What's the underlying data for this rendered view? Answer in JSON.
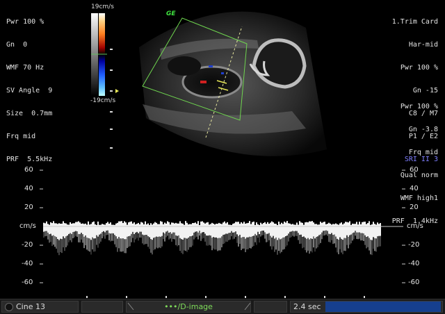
{
  "left_params": [
    "Pwr 100 %",
    "Gn  0",
    "WMF 70 Hz",
    "SV Angle  9",
    "Size  0.7mm",
    "Frq mid",
    "PRF  5.5kHz"
  ],
  "right_params_top": [
    "1.Trim Card",
    "Har-mid",
    "Pwr 100 %",
    "Gn -15",
    "C8 / M7",
    "P1 / E2"
  ],
  "sri_label": "SRI II 3",
  "right_params_bottom": [
    "Pwr 100 %",
    "Gn -3.8",
    "Frq mid",
    "Qual norm",
    "WMF high1",
    "PRF  1.4kHz"
  ],
  "color_scale": {
    "top": "19cm/s",
    "bottom": "-19cm/s"
  },
  "grey_map_badge": "GE",
  "doppler_axis": {
    "unit": "cm/s",
    "ticks_positive": [
      "60",
      "40",
      "20"
    ],
    "ticks_negative": [
      "-20",
      "-40",
      "-60"
    ]
  },
  "bottom_bar": {
    "cine_label": "Cine 13",
    "mode_label": "•••/D-image",
    "sweep_label": "2.4 sec"
  },
  "colors": {
    "grid_green": "#6fd64f",
    "sri_blue": "#7f7fff",
    "time_bar": "#163f8e"
  }
}
